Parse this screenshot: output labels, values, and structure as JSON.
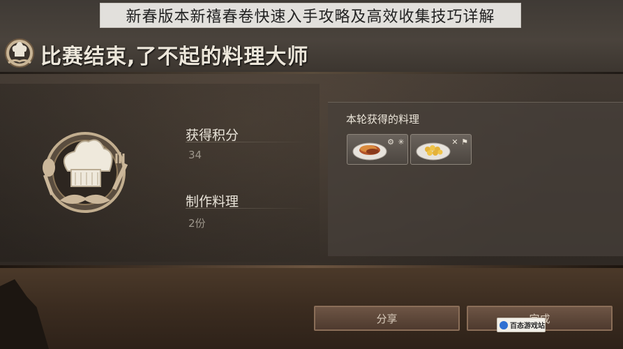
{
  "article_title": "新春版本新禧春卷快速入手攻略及高效收集技巧详解",
  "header": {
    "title": "比赛结束,了不起的料理大师"
  },
  "stats": {
    "points_label": "获得积分",
    "points_value": "34",
    "dishes_label": "制作料理",
    "dishes_value": "2份"
  },
  "results_panel": {
    "heading": "本轮获得的料理",
    "dishes": [
      {
        "icon": "sandwich-dish-icon",
        "tag_icon": "gear-tag-icon"
      },
      {
        "icon": "dumpling-dish-icon",
        "tag_icon": "knife-flag-icon"
      }
    ]
  },
  "buttons": {
    "share_label": "分享",
    "done_label": "完成"
  },
  "watermark": {
    "text": "百态游戏站"
  },
  "colors": {
    "title_text": "#ece6da",
    "value_text": "#9d968b",
    "button_text": "#d8cbbb"
  }
}
